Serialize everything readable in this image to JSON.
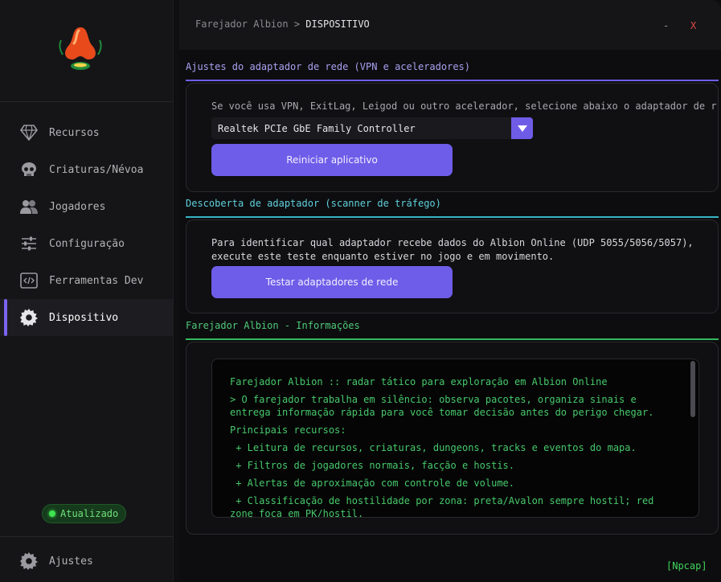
{
  "sidebar": {
    "items": [
      {
        "label": "Recursos",
        "icon": "diamond-icon"
      },
      {
        "label": "Criaturas/Névoa",
        "icon": "skull-icon"
      },
      {
        "label": "Jogadores",
        "icon": "users-icon"
      },
      {
        "label": "Configuração",
        "icon": "sliders-icon"
      },
      {
        "label": "Ferramentas Dev",
        "icon": "code-icon"
      },
      {
        "label": "Dispositivo",
        "icon": "gear-icon",
        "active": true
      }
    ],
    "status": "Atualizado",
    "settings_label": "Ajustes"
  },
  "header": {
    "breadcrumb_root": "Farejador Albion",
    "breadcrumb_sep": ">",
    "breadcrumb_current": "DISPOSITIVO",
    "minimize": "-",
    "close": "X"
  },
  "adapter_section": {
    "title": "Ajustes do adaptador de rede (VPN e aceleradores)",
    "description": "Se você usa VPN, ExitLag, Leigod ou outro acelerador, selecione abaixo o adaptador de r",
    "selected_adapter": "Realtek PCIe GbE Family Controller",
    "restart_button": "Reiniciar aplicativo"
  },
  "discovery_section": {
    "title": "Descoberta de adaptador (scanner de tráfego)",
    "line1": "Para identificar qual adaptador recebe dados do Albion Online (UDP 5055/5056/5057),",
    "line2": "execute este teste enquanto estiver no jogo e em movimento.",
    "test_button": "Testar adaptadores de rede"
  },
  "info_section": {
    "title": "Farejador Albion - Informações",
    "lines": [
      "Farejador Albion :: radar tático para exploração em Albion Online",
      "> O farejador trabalha em silêncio: observa pacotes, organiza sinais e",
      "entrega informação rápida para você tomar decisão antes do perigo chegar.",
      "Principais recursos:",
      " + Leitura de recursos, criaturas, dungeons, tracks e eventos do mapa.",
      " + Filtros de jogadores normais, facção e hostis.",
      " + Alertas de aproximação com controle de volume.",
      " + Classificação de hostilidade por zona: preta/Avalon sempre hostil; red",
      "zone foca em PK/hostil."
    ]
  },
  "footer": {
    "npcap": "[Npcap]"
  },
  "colors": {
    "accent": "#6e5de8",
    "green": "#47c96a",
    "cyan": "#3fb8c8",
    "danger": "#e04a4a"
  }
}
